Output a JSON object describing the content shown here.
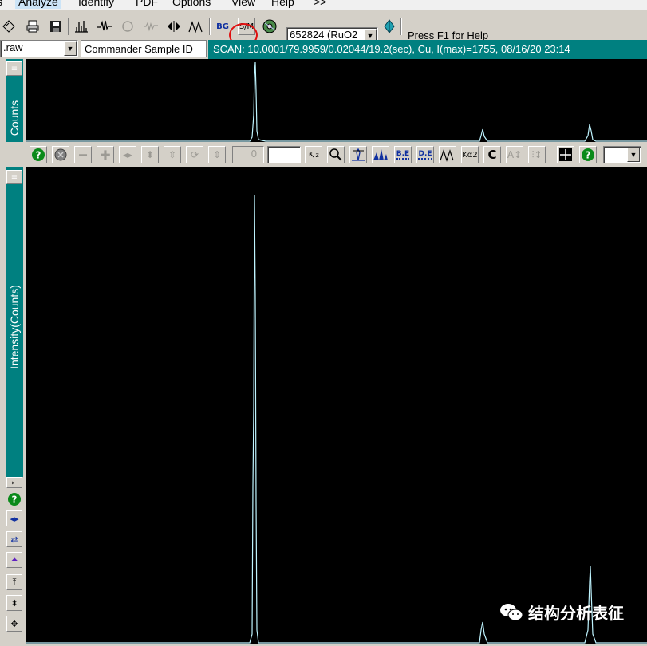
{
  "menu": {
    "items": [
      "s",
      "Analyze",
      "Identify",
      "PDF",
      "Options",
      "View",
      "Help",
      ">>"
    ]
  },
  "toolbar": {
    "pdf_select": "652824 (RuO2",
    "help_hint": "Press F1 for Help",
    "file_select": ".raw",
    "sample_id_button": "Commander Sample ID",
    "bg_label": "BG",
    "sm_label": "S/M"
  },
  "scan_info": "SCAN: 10.0001/79.9959/0.02044/19.2(sec), Cu, I(max)=1755, 08/16/20 23:14",
  "top_plot": {
    "ylabel": "Counts"
  },
  "main_toolbar": {
    "counter_value": "0",
    "be_label": "B.E",
    "de_label": "D.E",
    "ka2_label": "Kα2",
    "c_label": "C"
  },
  "main_plot": {
    "ylabel": "Intensity(Counts)"
  },
  "watermark": "结构分析表征",
  "colors": {
    "plot_bg": "#000000",
    "trace": "#bff4ff",
    "teal": "#008080",
    "face": "#d4d0c8",
    "highlight_circle": "#e01010"
  }
}
